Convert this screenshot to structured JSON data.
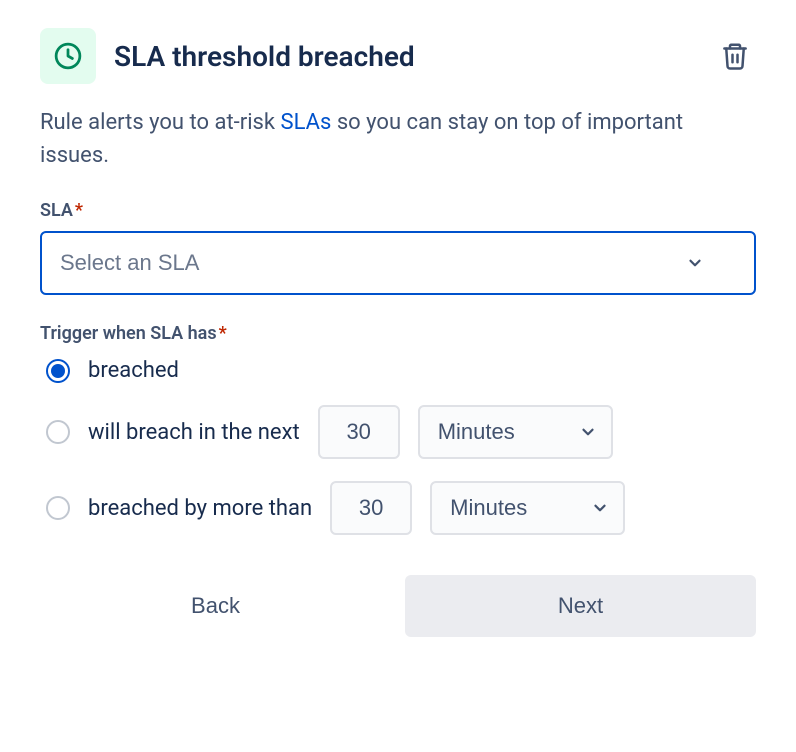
{
  "header": {
    "title": "SLA threshold breached"
  },
  "description": {
    "before_link": "Rule alerts you to at-risk ",
    "link_text": "SLAs",
    "after_link": " so you can stay on top of important issues."
  },
  "sla": {
    "label": "SLA",
    "placeholder": "Select an SLA"
  },
  "trigger": {
    "label": "Trigger when SLA has",
    "options": {
      "breached": "breached",
      "will_breach": "will breach in the next",
      "breached_by": "breached by more than"
    },
    "will_breach_value": "30",
    "will_breach_unit": "Minutes",
    "breached_by_value": "30",
    "breached_by_unit": "Minutes"
  },
  "buttons": {
    "back": "Back",
    "next": "Next"
  }
}
